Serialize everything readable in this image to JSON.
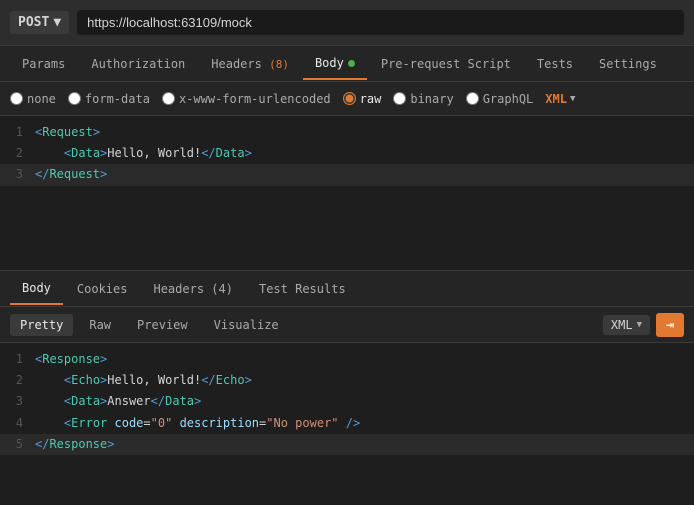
{
  "urlbar": {
    "method": "POST",
    "url": "https://localhost:63109/mock",
    "chevron": "▼"
  },
  "request_tabs": [
    {
      "id": "params",
      "label": "Params",
      "active": false,
      "badge": null,
      "dot": false
    },
    {
      "id": "authorization",
      "label": "Authorization",
      "active": false,
      "badge": null,
      "dot": false
    },
    {
      "id": "headers",
      "label": "Headers",
      "active": false,
      "badge": "(8)",
      "dot": false
    },
    {
      "id": "body",
      "label": "Body",
      "active": true,
      "badge": null,
      "dot": true
    },
    {
      "id": "pre-request-script",
      "label": "Pre-request Script",
      "active": false,
      "badge": null,
      "dot": false
    },
    {
      "id": "tests",
      "label": "Tests",
      "active": false,
      "badge": null,
      "dot": false
    },
    {
      "id": "settings",
      "label": "Settings",
      "active": false,
      "badge": null,
      "dot": false
    }
  ],
  "body_types": [
    {
      "id": "none",
      "label": "none",
      "checked": false
    },
    {
      "id": "form-data",
      "label": "form-data",
      "checked": false
    },
    {
      "id": "x-www-form-urlencoded",
      "label": "x-www-form-urlencoded",
      "checked": false
    },
    {
      "id": "raw",
      "label": "raw",
      "checked": true
    },
    {
      "id": "binary",
      "label": "binary",
      "checked": false
    },
    {
      "id": "graphql",
      "label": "GraphQL",
      "checked": false
    }
  ],
  "format_label": "XML",
  "request_code": [
    {
      "line": 1,
      "content": "<Request>",
      "highlighted": false
    },
    {
      "line": 2,
      "content": "    <Data>Hello, World!</Data>",
      "highlighted": false
    },
    {
      "line": 3,
      "content": "</Request>",
      "highlighted": true
    }
  ],
  "response_tabs": [
    {
      "id": "body",
      "label": "Body",
      "active": true
    },
    {
      "id": "cookies",
      "label": "Cookies",
      "active": false
    },
    {
      "id": "headers",
      "label": "Headers (4)",
      "active": false
    },
    {
      "id": "test-results",
      "label": "Test Results",
      "active": false
    }
  ],
  "response_view_tabs": [
    {
      "id": "pretty",
      "label": "Pretty",
      "active": true
    },
    {
      "id": "raw",
      "label": "Raw",
      "active": false
    },
    {
      "id": "preview",
      "label": "Preview",
      "active": false
    },
    {
      "id": "visualize",
      "label": "Visualize",
      "active": false
    }
  ],
  "response_format": "XML",
  "response_code": [
    {
      "line": 1,
      "content": "<Response>",
      "highlighted": false
    },
    {
      "line": 2,
      "content": "    <Echo>Hello, World!</Echo>",
      "highlighted": false
    },
    {
      "line": 3,
      "content": "    <Data>Answer</Data>",
      "highlighted": false
    },
    {
      "line": 4,
      "content": "    <Error code=\"0\" description=\"No power\" />",
      "highlighted": false
    },
    {
      "line": 5,
      "content": "</Response>",
      "highlighted": true
    }
  ],
  "wrap_icon": "⇥"
}
